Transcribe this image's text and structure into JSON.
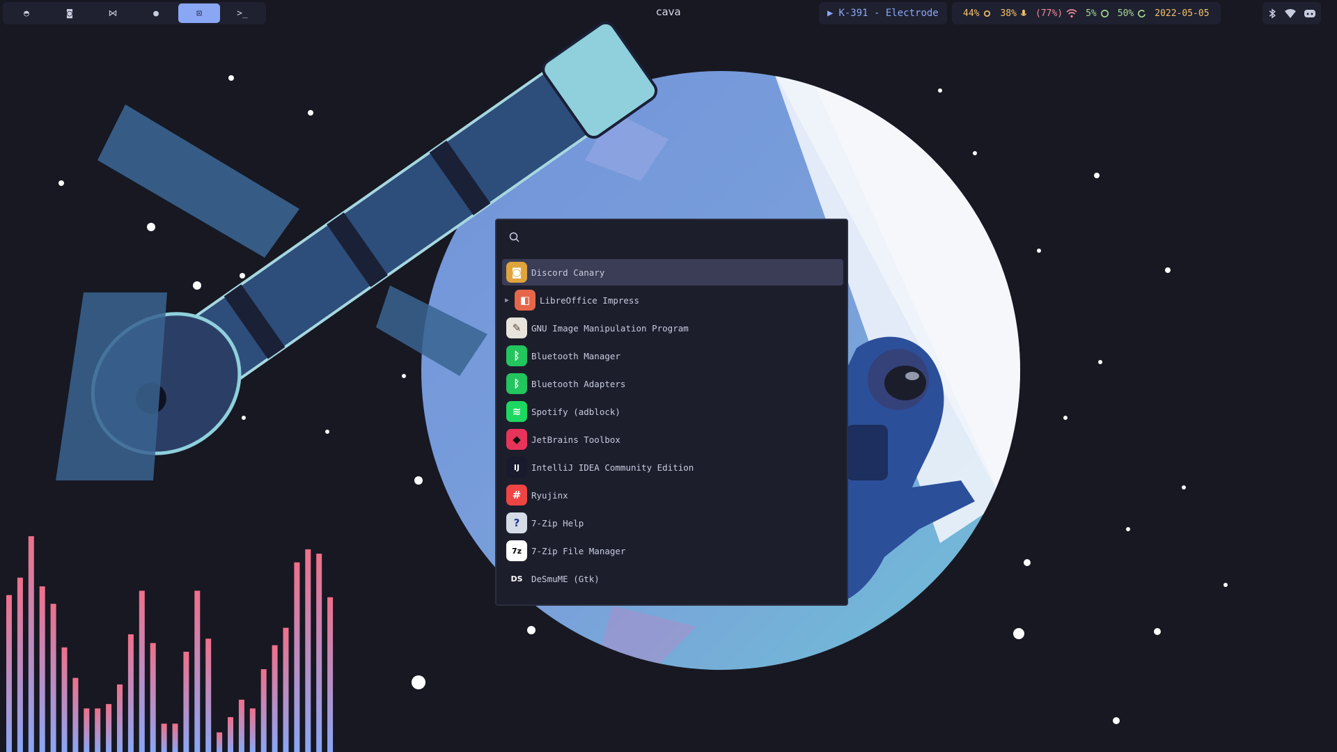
{
  "workspaces": [
    {
      "icon": "firefox-icon",
      "glyph": "◓"
    },
    {
      "icon": "discord-icon",
      "glyph": "◙"
    },
    {
      "icon": "vscode-icon",
      "glyph": "⋈"
    },
    {
      "icon": "spotify-icon",
      "glyph": "●"
    },
    {
      "icon": "screenshot-icon",
      "glyph": "⊡",
      "active": true
    },
    {
      "icon": "terminal-icon",
      "glyph": ">_"
    }
  ],
  "window_title": "cava",
  "media": {
    "play_glyph": "▶",
    "track": "K-391 - Electrode"
  },
  "status": {
    "brightness": "44%",
    "volume": "38%",
    "battery": "(77%)",
    "cpu": "5%",
    "memory": "50%",
    "date": "2022-05-05"
  },
  "colors": {
    "accent": "#8aa7f5",
    "brightness": "#f5c26b",
    "volume": "#f5c26b",
    "battery": "#f28b9c",
    "cpu": "#a6da95",
    "memory": "#a6da95",
    "date": "#f5c26b"
  },
  "tray": [
    "bluetooth-icon",
    "wifi-icon",
    "discord-icon"
  ],
  "launcher": {
    "search_placeholder": "",
    "apps": [
      {
        "name": "Discord Canary",
        "icon": "discord-canary-icon",
        "glyph": "◙",
        "bg": "#e0a43c",
        "fg": "#ffffff",
        "selected": true
      },
      {
        "name": "LibreOffice Impress",
        "icon": "libreoffice-impress-icon",
        "glyph": "◧",
        "bg": "#e6664a",
        "fg": "#ffffff",
        "expandable": true
      },
      {
        "name": "GNU Image Manipulation Program",
        "icon": "gimp-icon",
        "glyph": "✎",
        "bg": "#e8e4dc",
        "fg": "#5c4a3a"
      },
      {
        "name": "Bluetooth Manager",
        "icon": "bluetooth-icon",
        "glyph": "ᛒ",
        "bg": "#22c55e",
        "fg": "#ffffff"
      },
      {
        "name": "Bluetooth Adapters",
        "icon": "bluetooth-icon",
        "glyph": "ᛒ",
        "bg": "#22c55e",
        "fg": "#ffffff"
      },
      {
        "name": "Spotify (adblock)",
        "icon": "spotify-icon",
        "glyph": "≋",
        "bg": "#1ed760",
        "fg": "#ffffff"
      },
      {
        "name": "JetBrains Toolbox",
        "icon": "jetbrains-toolbox-icon",
        "glyph": "◆",
        "bg": "#e8345a",
        "fg": "#111111"
      },
      {
        "name": "IntelliJ IDEA Community Edition",
        "icon": "intellij-icon",
        "glyph": "IJ",
        "bg": "#1a1a2e",
        "fg": "#ffffff"
      },
      {
        "name": "Ryujinx",
        "icon": "ryujinx-icon",
        "glyph": "#",
        "bg": "#ef4444",
        "fg": "#ffffff"
      },
      {
        "name": "7-Zip Help",
        "icon": "help-icon",
        "glyph": "?",
        "bg": "#d6dbe8",
        "fg": "#1e3a8a"
      },
      {
        "name": "7-Zip File Manager",
        "icon": "7zip-icon",
        "glyph": "7z",
        "bg": "#ffffff",
        "fg": "#000000"
      },
      {
        "name": "DeSmuME (Gtk)",
        "icon": "desmume-icon",
        "glyph": "DS",
        "bg": "#1c1e2b",
        "fg": "#ffffff"
      }
    ]
  },
  "visualizer": {
    "bar_levels": [
      0.72,
      0.8,
      0.99,
      0.76,
      0.68,
      0.48,
      0.34,
      0.2,
      0.2,
      0.22,
      0.31,
      0.54,
      0.74,
      0.5,
      0.13,
      0.13,
      0.46,
      0.74,
      0.52,
      0.09,
      0.16,
      0.24,
      0.2,
      0.38,
      0.49,
      0.57,
      0.87,
      0.93,
      0.91,
      0.71
    ],
    "color_top": "#f0708a",
    "color_bottom": "#8aa7f5"
  }
}
